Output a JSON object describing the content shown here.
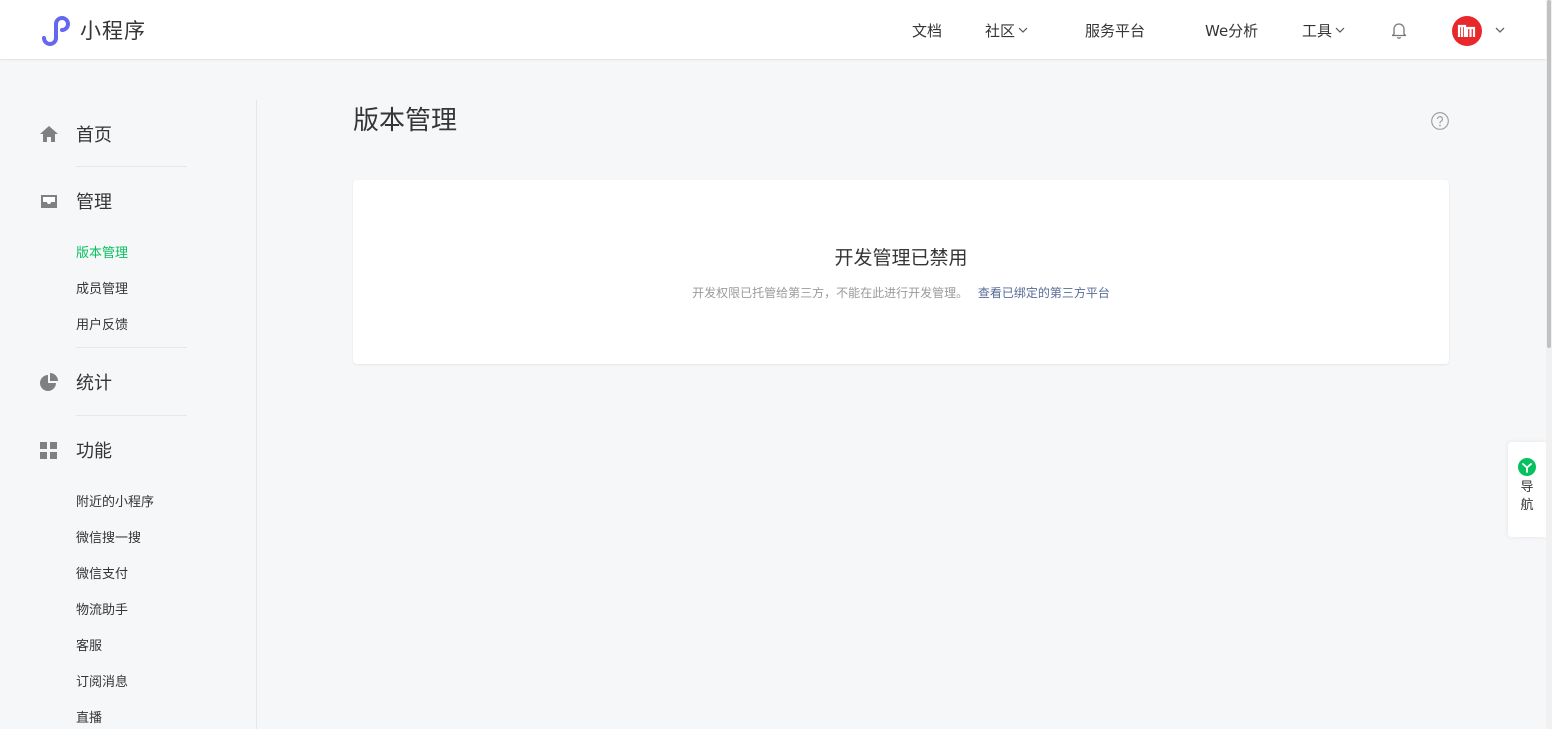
{
  "brand": {
    "name": "小程序",
    "accent": "#6467f0"
  },
  "topnav": {
    "docs": "文档",
    "community": "社区",
    "service_platform": "服务平台",
    "we_analysis": "We分析",
    "tools": "工具"
  },
  "sidebar": {
    "home": "首页",
    "manage": {
      "label": "管理",
      "items": [
        "版本管理",
        "成员管理",
        "用户反馈"
      ]
    },
    "stats": "统计",
    "features": {
      "label": "功能",
      "items": [
        "附近的小程序",
        "微信搜一搜",
        "微信支付",
        "物流助手",
        "客服",
        "订阅消息",
        "直播"
      ]
    },
    "active_color": "#07c160"
  },
  "main": {
    "title": "版本管理",
    "card": {
      "title": "开发管理已禁用",
      "desc": "开发权限已托管给第三方，不能在此进行开发管理。",
      "link": "查看已绑定的第三方平台"
    }
  },
  "float_nav": {
    "label": "导航",
    "color": "#07c160"
  }
}
